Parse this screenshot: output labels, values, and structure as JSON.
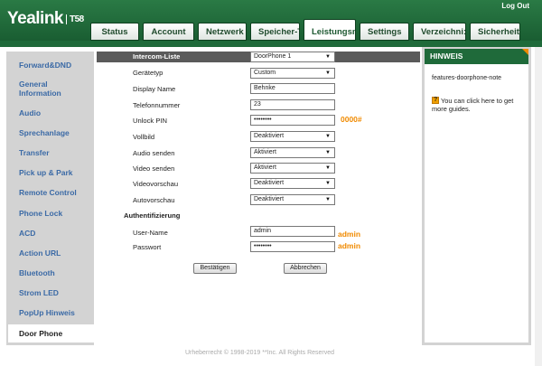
{
  "header": {
    "logo": "Yealink",
    "model": "T58",
    "logout": "Log Out",
    "tabs": [
      "Status",
      "Account",
      "Netzwerk",
      "Speicher-T",
      "Leistungsn",
      "Settings",
      "Verzeichni:",
      "Sicherheit"
    ],
    "active_tab": "Leistungsn"
  },
  "sidebar": {
    "items": [
      {
        "label": "Forward&DND"
      },
      {
        "label": "General Information"
      },
      {
        "label": "Audio"
      },
      {
        "label": "Sprechanlage"
      },
      {
        "label": "Transfer"
      },
      {
        "label": "Pick up & Park"
      },
      {
        "label": "Remote Control"
      },
      {
        "label": "Phone Lock"
      },
      {
        "label": "ACD"
      },
      {
        "label": "Action URL"
      },
      {
        "label": "Bluetooth"
      },
      {
        "label": "Strom LED"
      },
      {
        "label": "PopUp Hinweis"
      },
      {
        "label": "Door Phone"
      }
    ],
    "active": "Door Phone"
  },
  "form": {
    "intercom_label": "Intercom-Liste",
    "intercom_value": "DoorPhone 1",
    "device_type_label": "Gerätetyp",
    "device_type_value": "Custom",
    "display_name_label": "Display Name",
    "display_name_value": "Behnke",
    "phone_label": "Telefonnummer",
    "phone_value": "23",
    "unlock_pin_label": "Unlock PIN",
    "unlock_pin_value": "••••••••",
    "unlock_pin_hint": "0000#",
    "fullscreen_label": "Vollbild",
    "fullscreen_value": "Deaktiviert",
    "audio_send_label": "Audio senden",
    "audio_send_value": "Aktiviert",
    "video_send_label": "Video senden",
    "video_send_value": "Aktiviert",
    "video_preview_label": "Videovorschau",
    "video_preview_value": "Deaktiviert",
    "auto_preview_label": "Autovorschau",
    "auto_preview_value": "Deaktiviert",
    "auth_heading": "Authentifizierung",
    "username_label": "User-Name",
    "username_value": "admin",
    "username_hint": "admin",
    "password_label": "Passwort",
    "password_value": "••••••••",
    "password_hint": "admin",
    "confirm_button": "Bestätigen",
    "cancel_button": "Abbrechen"
  },
  "help": {
    "title": "HINWEIS",
    "note": "features-doorphone-note",
    "more": "You can click here to get more guides."
  },
  "footer": "Urheberrecht © 1998-2019 **Inc. All Rights Reserved",
  "colors": {
    "header_green": "#1f6a3a",
    "link_blue": "#3b6aa6",
    "hint_orange": "#f08a00"
  }
}
